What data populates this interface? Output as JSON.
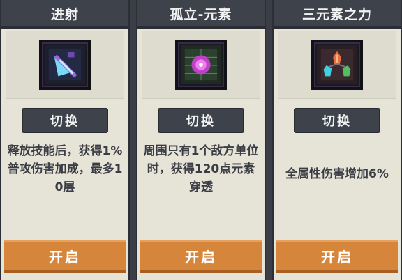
{
  "cards": [
    {
      "title": "进射",
      "switch_label": "切换",
      "description": "释放技能后，获得1%普攻伤害加成，最多10层",
      "open_label": "开启",
      "icon": "arrow-shot-icon",
      "icon_colors": [
        "#5ec8f0",
        "#8a5fd0"
      ]
    },
    {
      "title": "孤立-元素",
      "switch_label": "切换",
      "description": "周围只有1个敌方单位时，获得120点元素穿透",
      "open_label": "开启",
      "icon": "element-orb-icon",
      "icon_colors": [
        "#e050e0",
        "#40a080"
      ]
    },
    {
      "title": "三元素之力",
      "switch_label": "切换",
      "description": "全属性伤害增加6%",
      "open_label": "开启",
      "icon": "three-elements-icon",
      "icon_colors": [
        "#e07040",
        "#40d0e0",
        "#50c060"
      ]
    }
  ],
  "colors": {
    "header_bg": "#3d424b",
    "card_bg": "#e6e3d7",
    "button_orange": "#d5863b"
  }
}
